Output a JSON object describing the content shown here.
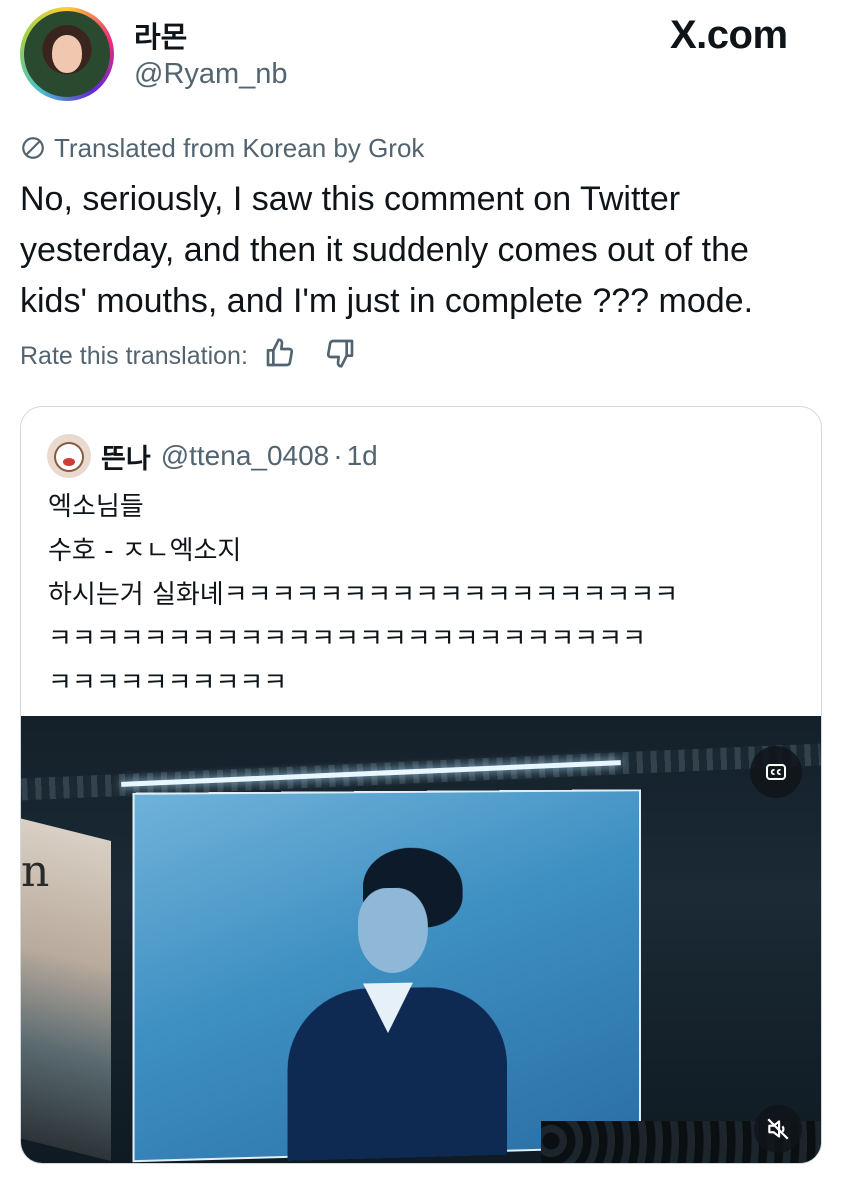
{
  "author": {
    "display_name": "라몬",
    "handle": "@Ryam_nb"
  },
  "brand": {
    "label": "X.com"
  },
  "translation": {
    "notice": "Translated from Korean by Grok",
    "rate_label": "Rate this translation:"
  },
  "tweet": {
    "text": "No, seriously, I saw this comment on Twitter yesterday, and then it suddenly comes out of the kids' mouths, and I'm just in complete ??? mode."
  },
  "quoted": {
    "display_name": "뜬나",
    "handle": "@ttena_0408",
    "separator": "·",
    "time": "1d",
    "lines": [
      "엑소님들",
      "수호 - ㅈㄴ엑소지",
      "하시는거 실화녜ㅋㅋㅋㅋㅋㅋㅋㅋㅋㅋㅋㅋㅋㅋㅋㅋㅋㅋㅋ",
      "ㅋㅋㅋㅋㅋㅋㅋㅋㅋㅋㅋㅋㅋㅋㅋㅋㅋㅋㅋㅋㅋㅋㅋㅋㅋ",
      "ㅋㅋㅋㅋㅋㅋㅋㅋㅋㅋ"
    ],
    "media": {
      "screen_letter": "n"
    }
  },
  "icons": {
    "translate": "translate-icon",
    "thumbs_up": "thumbs-up-icon",
    "thumbs_down": "thumbs-down-icon",
    "captions": "captions-icon",
    "mute": "mute-icon"
  },
  "colors": {
    "text": "#0f1419",
    "secondary": "#536471",
    "border": "#cfd9de"
  }
}
